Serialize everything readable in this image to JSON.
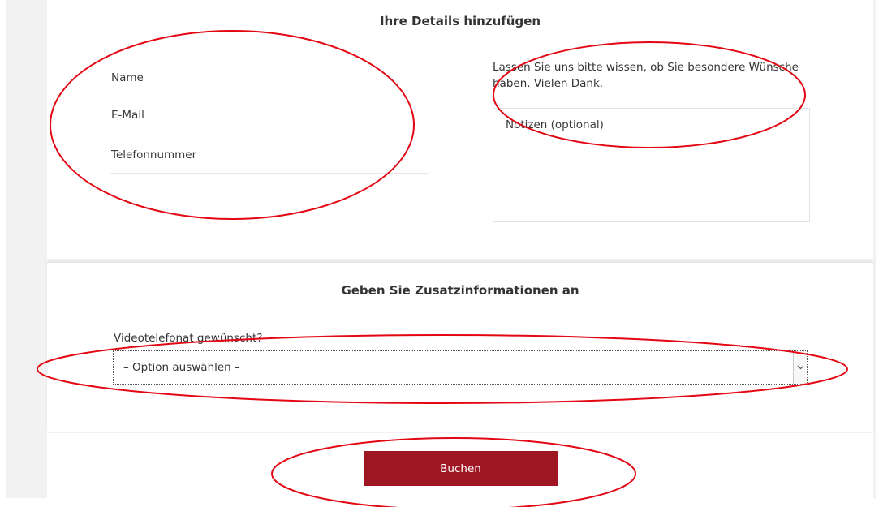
{
  "details_section": {
    "title": "Ihre Details hinzufügen",
    "fields": [
      {
        "placeholder": "Name"
      },
      {
        "placeholder": "E-Mail"
      },
      {
        "placeholder": "Telefonnummer"
      }
    ],
    "help_text": "Lassen Sie uns bitte wissen, ob Sie besondere Wünsche haben. Vielen Dank.",
    "notes_placeholder": "Notizen (optional)"
  },
  "extra_section": {
    "title": "Geben Sie Zusatzinformationen an",
    "select_label": "Videotelefonat gewünscht?",
    "select_value": "– Option auswählen –"
  },
  "book_button_label": "Buchen",
  "colors": {
    "accent": "#9d1622",
    "annotation": "#e30613"
  },
  "icons": {
    "select_arrow": "chevron-down-icon"
  }
}
